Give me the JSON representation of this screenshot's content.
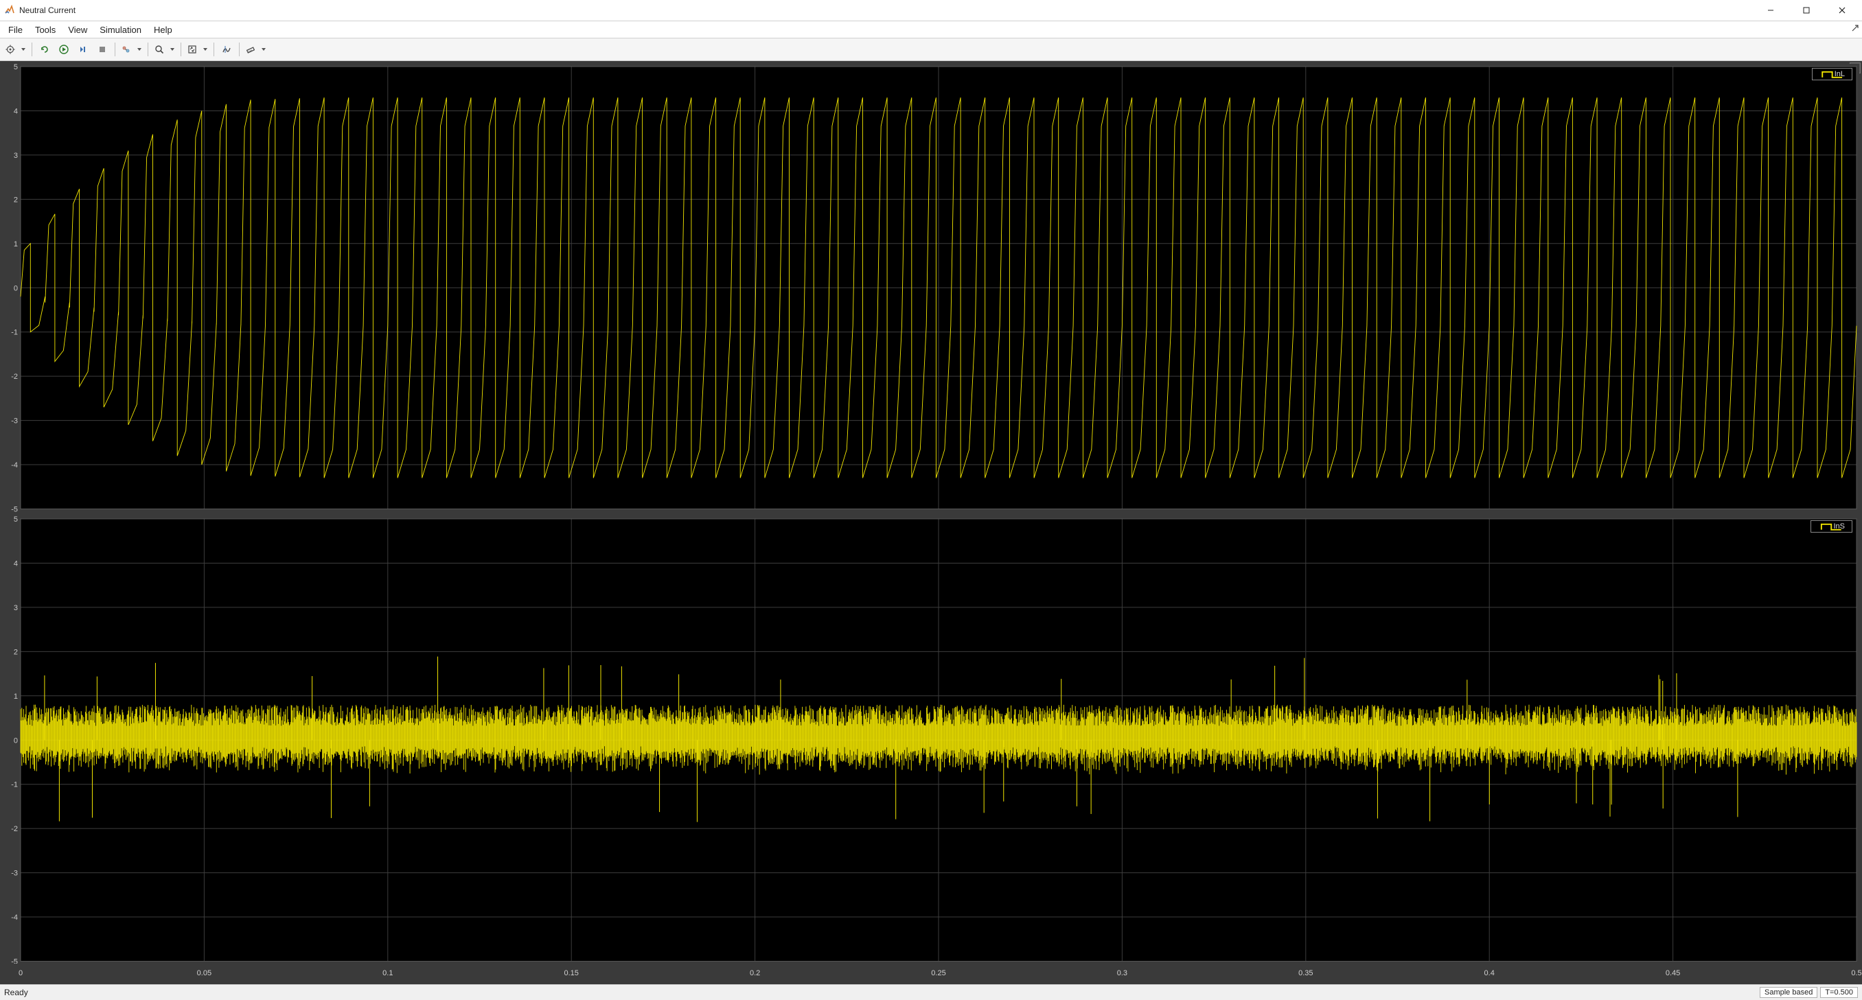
{
  "window": {
    "title": "Neutral Current"
  },
  "menu": {
    "file": "File",
    "tools": "Tools",
    "view": "View",
    "simulation": "Simulation",
    "help": "Help"
  },
  "status": {
    "ready": "Ready",
    "mode": "Sample based",
    "time": "T=0.500"
  },
  "legend": {
    "top": "InL",
    "bottom": "InS"
  },
  "chart_data": [
    {
      "type": "line",
      "name": "InL",
      "xlabel": "",
      "ylabel": "",
      "xlim": [
        0,
        0.5
      ],
      "ylim": [
        -5,
        5
      ],
      "yticks": [
        -5,
        -4,
        -3,
        -2,
        -1,
        0,
        1,
        2,
        3,
        4,
        5
      ],
      "xticks": [
        0,
        0.05,
        0.1,
        0.15,
        0.2,
        0.25,
        0.3,
        0.35,
        0.4,
        0.45,
        0.5
      ],
      "description": "Sawtooth-like neutral load current. Positive amplitude grows from ~1 at t=0 to ~4.3 by t≈0.05 then holds; negative amplitude grows in magnitude from ~-1 to ~-4.3 similarly. Frequency ≈ 150 Hz (75 cycles over 0.5 s).",
      "envelope_pos": [
        [
          0,
          1.0
        ],
        [
          0.01,
          2.0
        ],
        [
          0.02,
          2.7
        ],
        [
          0.03,
          3.3
        ],
        [
          0.04,
          3.8
        ],
        [
          0.05,
          4.1
        ],
        [
          0.06,
          4.25
        ],
        [
          0.08,
          4.3
        ],
        [
          0.5,
          4.3
        ]
      ],
      "envelope_neg": [
        [
          0,
          -1.0
        ],
        [
          0.01,
          -2.0
        ],
        [
          0.02,
          -2.7
        ],
        [
          0.03,
          -3.3
        ],
        [
          0.04,
          -3.8
        ],
        [
          0.05,
          -4.1
        ],
        [
          0.06,
          -4.25
        ],
        [
          0.08,
          -4.3
        ],
        [
          0.5,
          -4.3
        ]
      ],
      "freq_hz": 150,
      "series_color": "#f2e600"
    },
    {
      "type": "line",
      "name": "InS",
      "xlabel": "",
      "ylabel": "",
      "xlim": [
        0,
        0.5
      ],
      "ylim": [
        -5,
        5
      ],
      "yticks": [
        -5,
        -4,
        -3,
        -2,
        -1,
        0,
        1,
        2,
        3,
        4,
        5
      ],
      "xticks": [
        0,
        0.05,
        0.1,
        0.15,
        0.2,
        0.25,
        0.3,
        0.35,
        0.4,
        0.45,
        0.5
      ],
      "description": "High-frequency neutral source current centred on 0 with dense noise band roughly ±0.8 and occasional spikes reaching ±1.8 to ±2.",
      "noise_band": 0.8,
      "spike_amp": 1.9,
      "spike_count_approx": 40,
      "series_color": "#f2e600"
    }
  ]
}
